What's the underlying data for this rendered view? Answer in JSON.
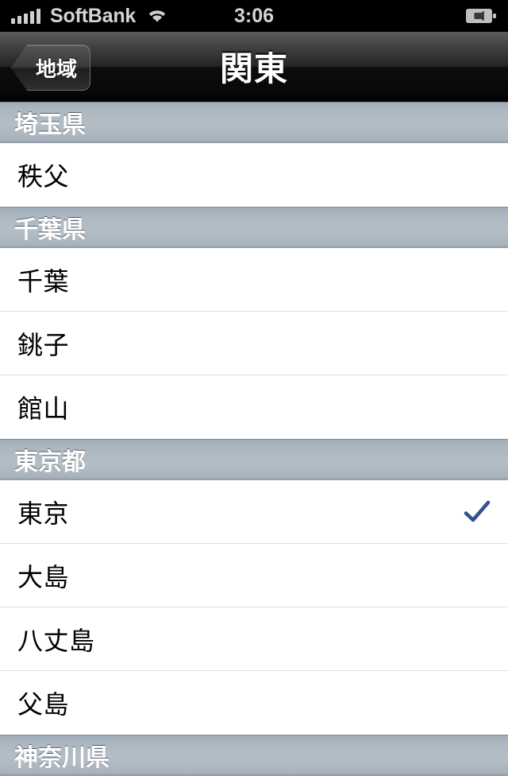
{
  "statusbar": {
    "carrier": "SoftBank",
    "time": "3:06",
    "signal_bars": 5,
    "wifi_icon": "wifi-icon",
    "battery_icon": "battery-charging-icon"
  },
  "navbar": {
    "back_label": "地域",
    "title": "関東",
    "back_icon": "back-chevron"
  },
  "list": {
    "sections": [
      {
        "header": "埼玉県",
        "rows": [
          {
            "label": "秩父",
            "checked": false
          }
        ]
      },
      {
        "header": "千葉県",
        "rows": [
          {
            "label": "千葉",
            "checked": false
          },
          {
            "label": "銚子",
            "checked": false
          },
          {
            "label": "館山",
            "checked": false
          }
        ]
      },
      {
        "header": "東京都",
        "rows": [
          {
            "label": "東京",
            "checked": true
          },
          {
            "label": "大島",
            "checked": false
          },
          {
            "label": "八丈島",
            "checked": false
          },
          {
            "label": "父島",
            "checked": false
          }
        ]
      },
      {
        "header": "神奈川県",
        "rows": []
      }
    ]
  },
  "colors": {
    "checkmark": "#34538c",
    "section_header_top": "#9fadb8",
    "section_header_bottom": "#99a5b0",
    "navbar_black": "#000000",
    "row_separator": "#e0e0e0"
  }
}
